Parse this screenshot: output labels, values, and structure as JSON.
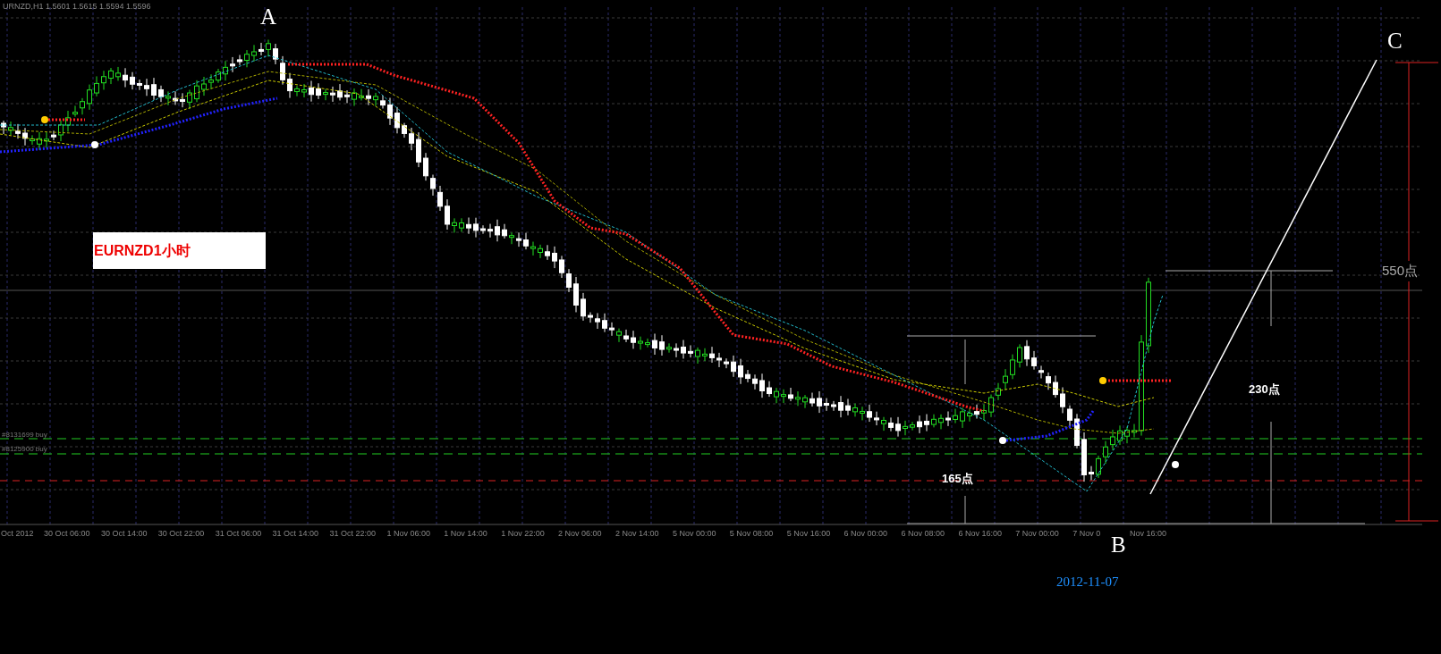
{
  "chart": {
    "header": "URNZD,H1  1.5601 1.5615 1.5594 1.5596",
    "point_labels": [
      {
        "text": "A"
      },
      {
        "text": "B"
      },
      {
        "text": "C"
      }
    ],
    "note_box": "EURNZD1小时",
    "order_lines": [
      {
        "label": "#8131699 buy"
      },
      {
        "label": "#8125900 buy"
      }
    ],
    "measures": [
      {
        "text": "165点"
      },
      {
        "text": "230点"
      },
      {
        "text": "550点"
      }
    ],
    "date_label": "2012-11-07",
    "x_labels": [
      "Oct 2012",
      "30 Oct 06:00",
      "30 Oct 14:00",
      "30 Oct 22:00",
      "31 Oct 06:00",
      "31 Oct 14:00",
      "31 Oct 22:00",
      "1 Nov 06:00",
      "1 Nov 14:00",
      "1 Nov 22:00",
      "2 Nov 06:00",
      "2 Nov 14:00",
      "5 Nov 00:00",
      "5 Nov 08:00",
      "5 Nov 16:00",
      "6 Nov 00:00",
      "6 Nov 08:00",
      "6 Nov 16:00",
      "7 Nov 00:00",
      "7 Nov 0",
      "Nov 16:00"
    ]
  }
}
